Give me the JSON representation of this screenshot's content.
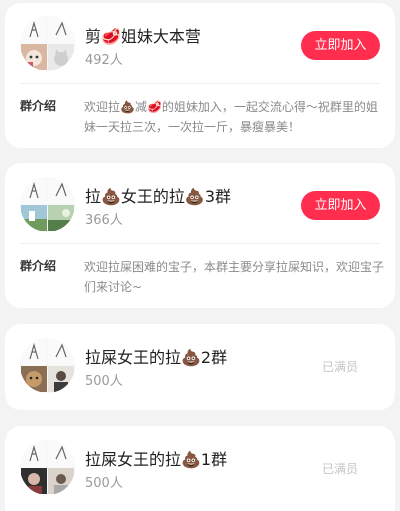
{
  "groups": [
    {
      "name": "剪🥩姐妹大本营",
      "members": "492人",
      "action_label": "立即加入",
      "intro_label": "群介绍",
      "intro_text": "欢迎拉💩减🥩的姐妹加入，一起交流心得～祝群里的姐妹一天拉三次，一次拉一斤，暴瘦暴美！"
    },
    {
      "name": "拉💩女王的拉💩3群",
      "members": "366人",
      "action_label": "立即加入",
      "intro_label": "群介绍",
      "intro_text": "欢迎拉屎困难的宝子，本群主要分享拉屎知识，欢迎宝子们来讨论~"
    },
    {
      "name": "拉屎女王的拉💩2群",
      "members": "500人",
      "status_label": "已满员"
    },
    {
      "name": "拉屎女王的拉💩1群",
      "members": "500人",
      "status_label": "已满员"
    }
  ],
  "colors": {
    "accent": "#ff2d4e",
    "background": "#f3f3f3",
    "card": "#ffffff",
    "muted_text": "#9a9a9a"
  }
}
